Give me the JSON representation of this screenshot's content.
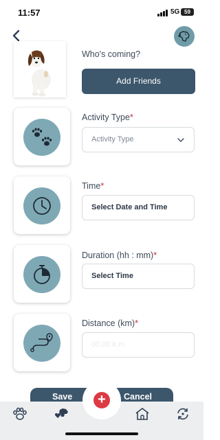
{
  "status_bar": {
    "time": "11:57",
    "network": "5G",
    "battery": "59"
  },
  "header": {
    "back_icon": "chevron-left-icon",
    "profile_icon": "dog-head-icon"
  },
  "guests": {
    "label": "Who's coming?",
    "button_label": "Add Friends"
  },
  "activity_type": {
    "label": "Activity Type",
    "required_mark": "*",
    "selected": "Activity Type",
    "icon": "paw-prints-icon"
  },
  "time": {
    "label": "Time",
    "required_mark": "*",
    "value": "Select Date and Time",
    "icon": "clock-icon"
  },
  "duration": {
    "label": "Duration (hh : mm)",
    "required_mark": "*",
    "value": "Select Time",
    "icon": "stopwatch-icon"
  },
  "distance": {
    "label": "Distance (km)",
    "required_mark": "*",
    "placeholder": "00.00 k.m",
    "icon": "route-pin-icon"
  },
  "actions": {
    "save_label": "Save",
    "cancel_label": "Cancel",
    "add_symbol": "+"
  },
  "tabs": [
    {
      "icon": "paw-icon"
    },
    {
      "icon": "dog-heart-icon"
    },
    {
      "icon": "add-icon"
    },
    {
      "icon": "dog-house-icon"
    },
    {
      "icon": "refresh-icon"
    }
  ],
  "colors": {
    "accent": "#7fa8b5",
    "primary_button": "#3c566b",
    "fab": "#dc3a44",
    "required": "#c8293b"
  }
}
